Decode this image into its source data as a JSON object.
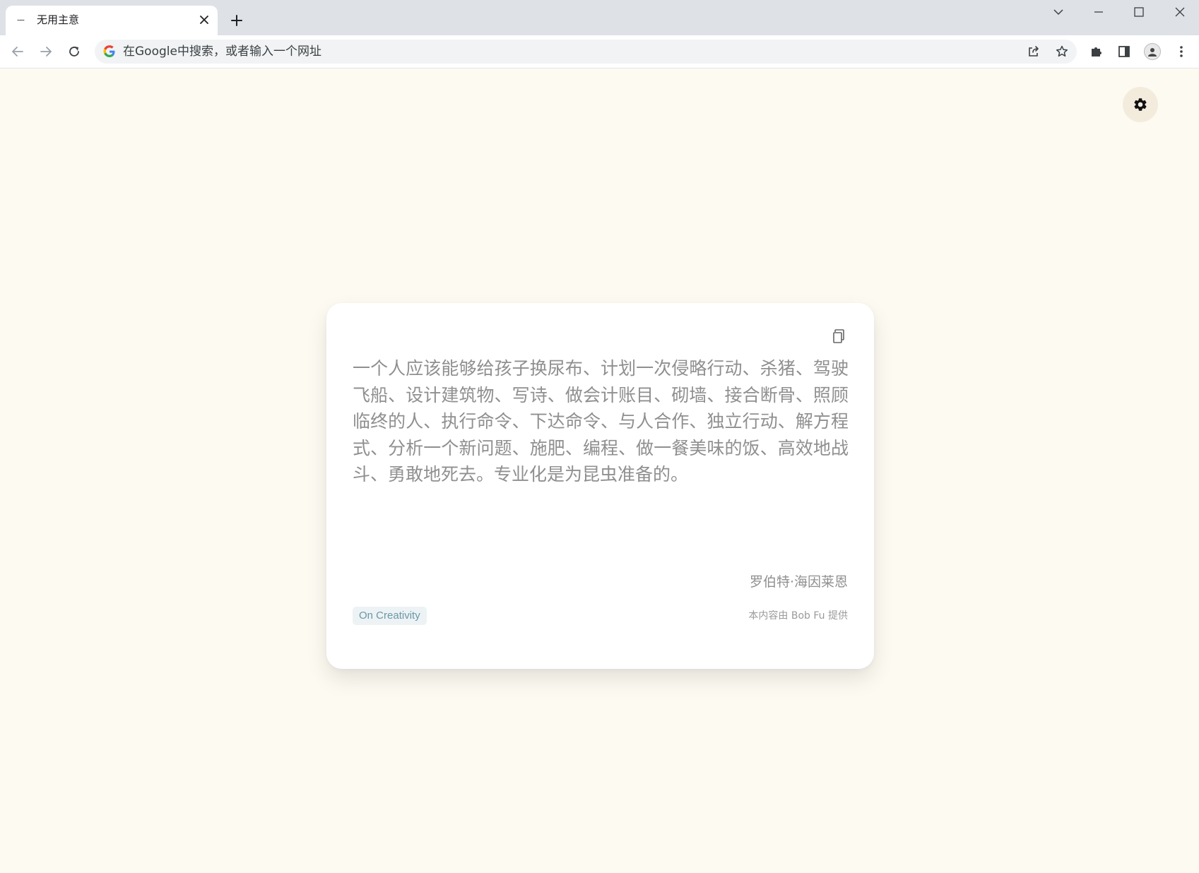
{
  "browser": {
    "tab": {
      "favicon_text": "---",
      "title": "无用主意"
    },
    "omnibox": {
      "placeholder": "在Google中搜索，或者输入一个网址"
    }
  },
  "card": {
    "quote": "一个人应该能够给孩子换尿布、计划一次侵略行动、杀猪、驾驶飞船、设计建筑物、写诗、做会计账目、砌墙、接合断骨、照顾临终的人、执行命令、下达命令、与人合作、独立行动、解方程式、分析一个新问题、施肥、编程、做一餐美味的饭、高效地战斗、勇敢地死去。专业化是为昆虫准备的。",
    "author": "罗伯特·海因莱恩",
    "tag": "On Creativity",
    "credit": "本内容由 Bob Fu 提供"
  },
  "colors": {
    "page_background": "#fdfaf2",
    "tag_text": "#6a98a8",
    "tag_background": "#edf2f4",
    "quote_text": "#8f8f8f"
  },
  "icons": {
    "settings": "gear-icon",
    "copy": "copy-icon"
  }
}
